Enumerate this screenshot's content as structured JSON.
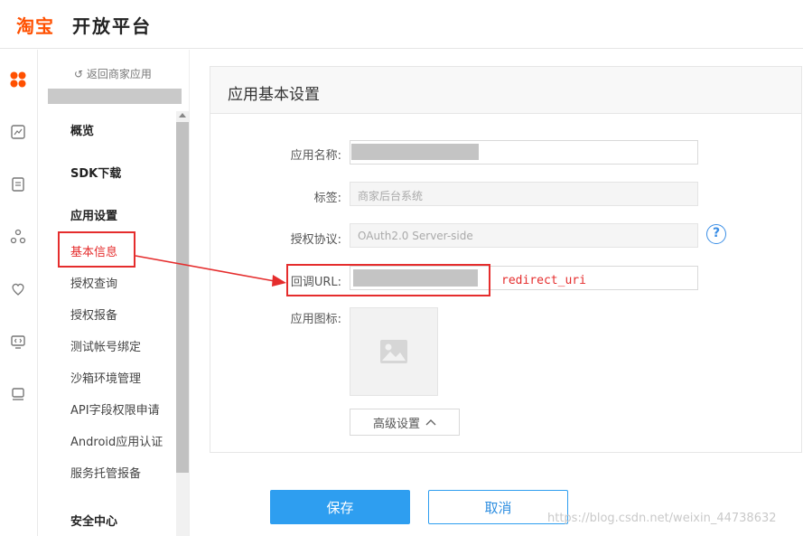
{
  "header": {
    "logo_mark": "淘宝",
    "logo_text": "开放平台"
  },
  "icon_rail": [
    "apps-grid-icon",
    "photo-icon",
    "document-icon",
    "share-nodes-icon",
    "heart-icon",
    "code-screen-icon",
    "stack-icon"
  ],
  "subnav": {
    "back_link": "↺ 返回商家应用",
    "groups": {
      "overview": "概览",
      "sdk": "SDK下载",
      "app_settings": "应用设置",
      "security": "安全中心"
    },
    "items": [
      "基本信息",
      "授权查询",
      "授权报备",
      "测试帐号绑定",
      "沙箱环境管理",
      "API字段权限申请",
      "Android应用认证",
      "服务托管报备"
    ]
  },
  "card": {
    "title": "应用基本设置",
    "fields": {
      "app_name_label": "应用名称:",
      "tag_label": "标签:",
      "tag_value": "商家后台系统",
      "auth_label": "授权协议:",
      "auth_value": "OAuth2.0 Server-side",
      "callback_label": "回调URL:",
      "icon_label": "应用图标:"
    },
    "advanced_button": "高级设置",
    "annotation": "redirect_uri"
  },
  "actions": {
    "save": "保存",
    "cancel": "取消"
  },
  "watermark": "https://blog.csdn.net/weixin_44738632",
  "colors": {
    "accent": "#2e9ef0",
    "brand": "#ff5000",
    "highlight": "#e52d2d"
  }
}
